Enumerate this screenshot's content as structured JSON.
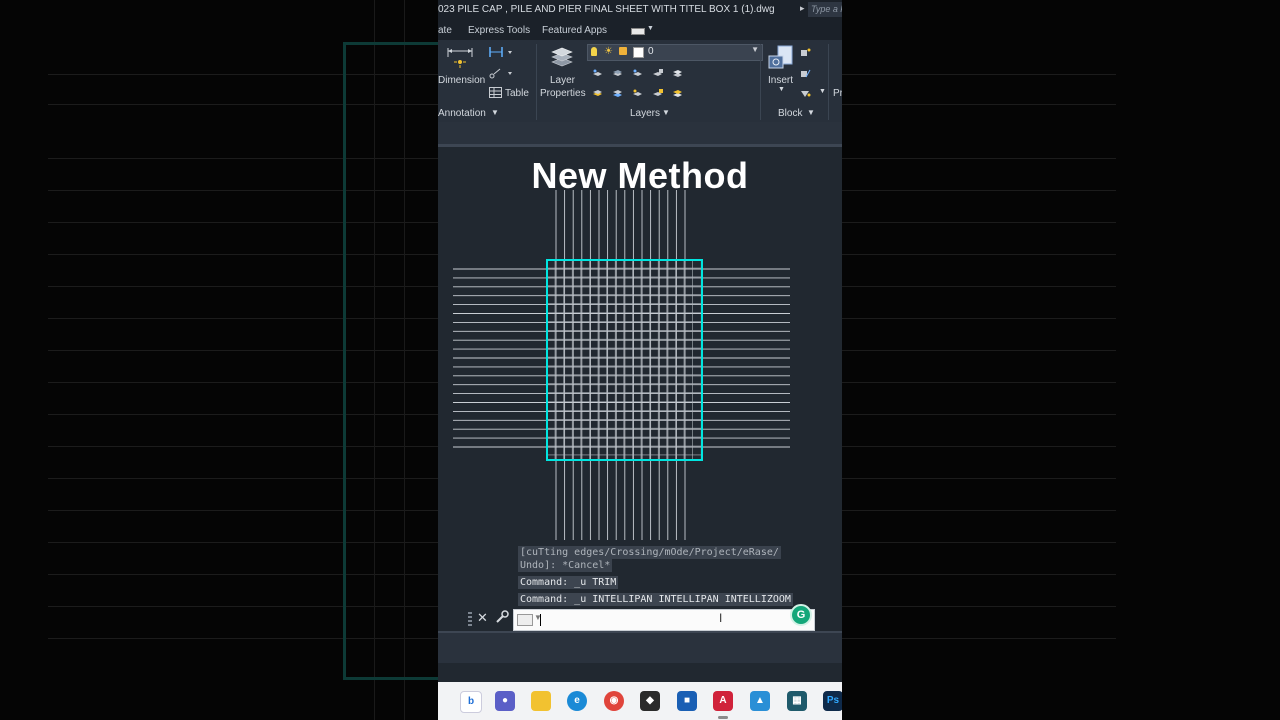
{
  "window": {
    "title": "023   PILE CAP , PILE AND PIER FINAL SHEET WITH TITEL BOX 1 (1).dwg",
    "search_placeholder": "Type a k"
  },
  "tabs": [
    {
      "label": "ate"
    },
    {
      "label": "Express Tools"
    },
    {
      "label": "Featured Apps"
    }
  ],
  "ribbon": {
    "annotation_panel": {
      "label": "Annotation",
      "dimension_label": "Dimension",
      "table_label": "Table"
    },
    "layers_panel": {
      "label": "Layers",
      "layer_properties_line1": "Layer",
      "layer_properties_line2": "Properties",
      "current_layer": "0"
    },
    "block_panel": {
      "label": "Block",
      "insert_label": "Insert",
      "cut_off_label": "Pr"
    }
  },
  "overlay": {
    "title": "New Method"
  },
  "command_line": {
    "history": [
      "[cuTting edges/Crossing/mOde/Project/eRase/",
      "Undo]: *Cancel*",
      "Command: _u TRIM",
      "Command: _u INTELLIPAN INTELLIPAN INTELLIZOOM"
    ],
    "input_value": ""
  },
  "grammarly": {
    "badge": "G"
  },
  "taskbar": {
    "icons": [
      "bing-b",
      "teams",
      "files",
      "edge",
      "chrome",
      "unity",
      "store",
      "autocad",
      "sketchup",
      "sequence",
      "photoshop"
    ],
    "autocad_label": "A",
    "photoshop_label": "Ps"
  },
  "colors": {
    "accent_cyan": "#00e5e0",
    "canvas": "#212830",
    "ribbon": "#28303b"
  }
}
